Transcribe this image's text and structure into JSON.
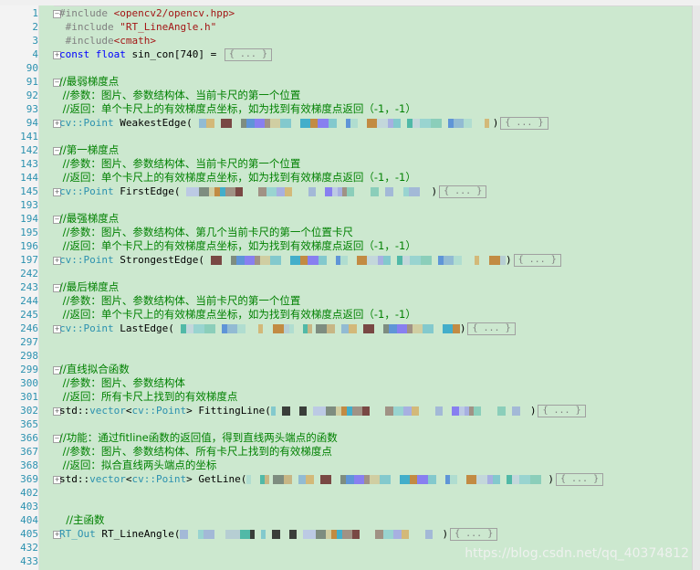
{
  "lines": [
    {
      "n": "1",
      "code": [
        [
          "pp",
          "#include "
        ],
        [
          "str",
          "<opencv2/opencv.hpp>"
        ]
      ],
      "fold": "minus"
    },
    {
      "n": "2",
      "code": [
        [
          "pp",
          " #include "
        ],
        [
          "str",
          "\"RT_LineAngle.h\""
        ]
      ]
    },
    {
      "n": "3",
      "code": [
        [
          "pp",
          " #include"
        ],
        [
          "str",
          "<cmath>"
        ]
      ]
    },
    {
      "n": "4",
      "code": [
        [
          "kw",
          "const float"
        ],
        [
          "",
          "sin_con[740] = "
        ]
      ],
      "fold": "plus",
      "collapsed": "{ ... }"
    },
    {
      "n": "90",
      "code": []
    },
    {
      "n": "91",
      "code": [
        [
          "cm",
          "//最弱梯度点"
        ]
      ],
      "fold": "minus"
    },
    {
      "n": "92",
      "code": [
        [
          "cm",
          " //参数：图片、参数结构体、当前卡尺的第一个位置"
        ]
      ]
    },
    {
      "n": "93",
      "code": [
        [
          "cm",
          " //返回：单个卡尺上的有效梯度点坐标，如为找到有效梯度点返回（-1，-1）"
        ]
      ]
    },
    {
      "n": "94",
      "code": [
        [
          "ty",
          "cv::Point"
        ],
        [
          "",
          "WeakestEdge("
        ]
      ],
      "fold": "plus",
      "blur": true,
      "collapsed": "{ ... }"
    },
    {
      "n": "141",
      "code": []
    },
    {
      "n": "142",
      "code": [
        [
          "cm",
          "//第一梯度点"
        ]
      ],
      "fold": "minus"
    },
    {
      "n": "143",
      "code": [
        [
          "cm",
          " //参数：图片、参数结构体、当前卡尺的第一个位置"
        ]
      ]
    },
    {
      "n": "144",
      "code": [
        [
          "cm",
          " //返回：单个卡尺上的有效梯度点坐标，如为找到有效梯度点返回（-1，-1）"
        ]
      ]
    },
    {
      "n": "145",
      "code": [
        [
          "ty",
          "cv::Point"
        ],
        [
          "",
          "FirstEdge("
        ]
      ],
      "fold": "plus",
      "blur": true,
      "collapsed": "{ ... }"
    },
    {
      "n": "193",
      "code": []
    },
    {
      "n": "194",
      "code": [
        [
          "cm",
          "//最强梯度点"
        ]
      ],
      "fold": "minus"
    },
    {
      "n": "195",
      "code": [
        [
          "cm",
          " //参数：图片、参数结构体、第几个当前卡尺的第一个位置卡尺"
        ]
      ]
    },
    {
      "n": "196",
      "code": [
        [
          "cm",
          " //返回：单个卡尺上的有效梯度点坐标，如为找到有效梯度点返回（-1，-1）"
        ]
      ]
    },
    {
      "n": "197",
      "code": [
        [
          "ty",
          "cv::Point"
        ],
        [
          "",
          "StrongestEdge("
        ]
      ],
      "fold": "plus",
      "blur": true,
      "collapsed": "{ ... }"
    },
    {
      "n": "242",
      "code": []
    },
    {
      "n": "243",
      "code": [
        [
          "cm",
          "//最后梯度点"
        ]
      ],
      "fold": "minus"
    },
    {
      "n": "244",
      "code": [
        [
          "cm",
          " //参数：图片、参数结构体、当前卡尺的第一个位置"
        ]
      ]
    },
    {
      "n": "245",
      "code": [
        [
          "cm",
          " //返回：单个卡尺上的有效梯度点坐标，如为找到有效梯度点返回（-1，-1）"
        ]
      ]
    },
    {
      "n": "246",
      "code": [
        [
          "ty",
          "cv::Point"
        ],
        [
          "",
          "LastEdge("
        ]
      ],
      "fold": "plus",
      "blur": true,
      "collapsed": "{ ... }"
    },
    {
      "n": "297",
      "code": []
    },
    {
      "n": "298",
      "code": []
    },
    {
      "n": "299",
      "code": [
        [
          "cm",
          "//直线拟合函数"
        ]
      ],
      "fold": "minus"
    },
    {
      "n": "300",
      "code": [
        [
          "cm",
          " //参数：图片、参数结构体"
        ]
      ]
    },
    {
      "n": "301",
      "code": [
        [
          "cm",
          " //返回：所有卡尺上找到的有效梯度点"
        ]
      ]
    },
    {
      "n": "302",
      "code": [
        [
          "",
          "std::"
        ],
        [
          "ty",
          "vector"
        ],
        [
          "",
          "<"
        ],
        [
          "ty",
          "cv::Point"
        ],
        [
          "",
          "> FittingLine("
        ]
      ],
      "fold": "plus",
      "blur": true,
      "collapsed": "{ ... }"
    },
    {
      "n": "365",
      "code": []
    },
    {
      "n": "366",
      "code": [
        [
          "cm",
          "//功能：通过fitline函数的返回值，得到直线两头端点的函数"
        ]
      ],
      "fold": "minus"
    },
    {
      "n": "367",
      "code": [
        [
          "cm",
          " //参数：图片、参数结构体、所有卡尺上找到的有效梯度点"
        ]
      ]
    },
    {
      "n": "368",
      "code": [
        [
          "cm",
          " //返回：拟合直线两头端点的坐标"
        ]
      ]
    },
    {
      "n": "369",
      "code": [
        [
          "",
          "std::"
        ],
        [
          "ty",
          "vector"
        ],
        [
          "",
          "<"
        ],
        [
          "ty",
          "cv::Point"
        ],
        [
          "",
          "> GetLine("
        ]
      ],
      "fold": "plus",
      "blur": true,
      "collapsed": "{ ... }"
    },
    {
      "n": "402",
      "code": []
    },
    {
      "n": "403",
      "code": []
    },
    {
      "n": "404",
      "code": [
        [
          "cm",
          "  //主函数"
        ]
      ]
    },
    {
      "n": "405",
      "code": [
        [
          "ty",
          "RT_Out"
        ],
        [
          "",
          "RT_LineAngle("
        ]
      ],
      "fold": "plus",
      "blur": true,
      "collapsed": "{ ... }"
    },
    {
      "n": "432",
      "code": []
    },
    {
      "n": "433",
      "code": []
    }
  ],
  "watermark": "https://blog.csdn.net/qq_40374812",
  "colors": {
    "editor_bg": "#cce8cf",
    "line_number": "#2b91af",
    "comment": "#008000",
    "keyword": "#0000ff",
    "type": "#2b91af",
    "string": "#a31515",
    "preprocessor": "#808080"
  }
}
